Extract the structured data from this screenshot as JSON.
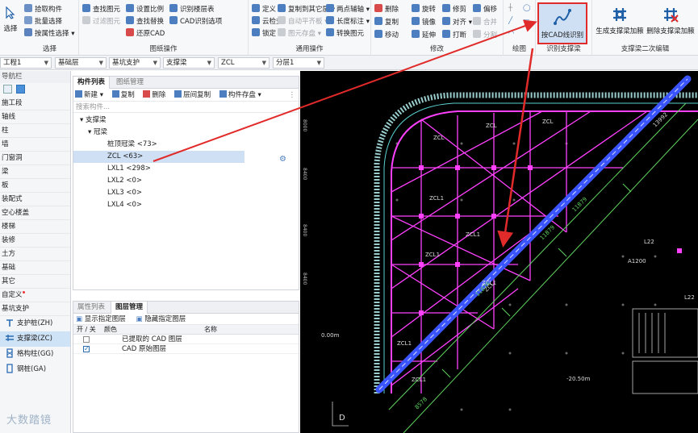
{
  "ribbon": {
    "select_label": "选择",
    "groups": {
      "select": {
        "label": "选择",
        "items": [
          "拾取构件",
          "批量选择",
          "按属性选择"
        ]
      },
      "drawing_ops": {
        "label": "图纸操作",
        "items": [
          "查找图元",
          "过滤图元",
          "设置比例",
          "查找替换",
          "还原CAD",
          "识别楼层表",
          "CAD识别选项"
        ]
      },
      "common_ops": {
        "label": "通用操作",
        "items": [
          "定义",
          "云检查",
          "锁定",
          "复制到其它层",
          "自动平齐板",
          "图元存盘",
          "两点辅轴",
          "长度标注",
          "转换图元"
        ]
      },
      "modify": {
        "label": "修改",
        "items": [
          "删除",
          "旋转",
          "修剪",
          "偏移",
          "复制",
          "镜像",
          "对齐",
          "合并",
          "移动",
          "延伸",
          "打断",
          "分割"
        ]
      },
      "draw": {
        "label": "绘图"
      },
      "identify": {
        "label": "识别支撑梁",
        "button": "按CAD线识别"
      },
      "secondary_edit": {
        "label": "支撑梁二次编辑",
        "buttons": [
          "生成支撑梁加腋",
          "删除支撑梁加腋"
        ]
      }
    }
  },
  "filters": [
    "工程1",
    "基础层",
    "基坑支护",
    "支撑梁",
    "ZCL",
    "分层1"
  ],
  "nav": {
    "title": "导航栏",
    "items": [
      "施工段",
      "轴线",
      "柱",
      "墙",
      "门窗洞",
      "梁",
      "板",
      "装配式",
      "空心楼盖",
      "楼梯",
      "装修",
      "土方",
      "基础",
      "其它",
      "自定义",
      "基坑支护"
    ],
    "sub_items": [
      "支护桩(ZH)",
      "支撑梁(ZC)",
      "格构柱(GG)",
      "钢桩(GA)"
    ]
  },
  "component_panel": {
    "tabs": [
      "构件列表",
      "图纸管理"
    ],
    "toolbar": [
      "新建",
      "复制",
      "删除",
      "层间复制",
      "构件存盘"
    ],
    "search_placeholder": "搜索构件...",
    "tree": [
      "支撑梁",
      "冠梁",
      "桩顶冠梁 <73>",
      "ZCL <63>",
      "LXL1 <298>",
      "LXL2 <0>",
      "LXL3 <0>",
      "LXL4 <0>"
    ]
  },
  "layer_panel": {
    "tabs": [
      "属性列表",
      "图层管理"
    ],
    "toolbar": [
      "显示指定图层",
      "隐藏指定图层"
    ],
    "columns": [
      "开 / 关",
      "颜色",
      "名称"
    ],
    "rows": [
      {
        "name": "已提取的 CAD 图层",
        "on": false
      },
      {
        "name": "CAD 原始图层",
        "on": true
      }
    ]
  },
  "canvas": {
    "labels": {
      "zcl": "ZCL",
      "zcl1": "ZCL1",
      "dim": "11879",
      "dim2": "13992",
      "dim3": "8578",
      "l22": "L22",
      "a1200": "A1200",
      "level_neg": "-20.50m",
      "level_zero": "0.00m",
      "grid_d": "D"
    }
  },
  "watermark": "大数踏镜",
  "colors": {
    "highlight_red": "#e12a2a",
    "beam_magenta": "#ff40ff",
    "beam_blue": "#3a55ff",
    "grid_green": "#5fd35f",
    "canvas_bg": "#000000"
  }
}
